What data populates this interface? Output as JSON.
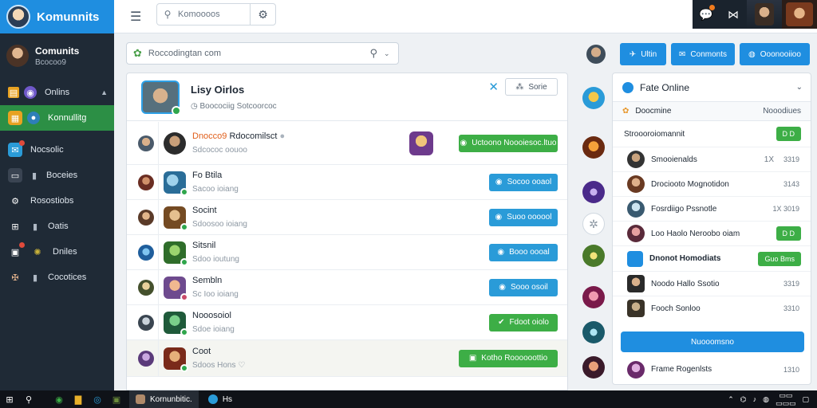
{
  "app": {
    "brand": "Komunnits"
  },
  "user": {
    "name": "Comunits",
    "status": "Bcocoo9"
  },
  "sidebar": {
    "items": [
      {
        "label": "Onlins",
        "icon": "planet-icon",
        "color": "#6f58c9"
      },
      {
        "label": "Konnullitg",
        "icon": "chat-icon",
        "color": "#e8a221",
        "active": true
      },
      {
        "label": "Nocsolic",
        "icon": "bell-icon",
        "color": "#2a9bd8"
      },
      {
        "label": "Boceies",
        "icon": "monitor-icon",
        "color": "#3a4452"
      },
      {
        "label": "Rosostiobs",
        "icon": "gear-icon",
        "color": "#3a4452"
      },
      {
        "label": "Oatis",
        "icon": "grid-icon",
        "color": "#3a4452"
      },
      {
        "label": "Dniles",
        "icon": "dashboard-icon",
        "color": "#3a4452"
      },
      {
        "label": "Cocotices",
        "icon": "gamepad-icon",
        "color": "#3a4452"
      }
    ]
  },
  "topbar": {
    "search_placeholder": "Komoooos"
  },
  "mainsearch": {
    "placeholder": "Roccodingtan com"
  },
  "main": {
    "title": "Lisy Oirlos",
    "subtitle": "Boocociig Sotcoorcoc",
    "sort_label": "Sorie",
    "rows": [
      {
        "name_highlight": "Dnocco9 ",
        "name": "Rdocomilsct",
        "sub": "Sdcococ oouoo",
        "button": "Uctoono Noooiesoc.ltuo",
        "button_style": "greenwide"
      },
      {
        "name": "Fo Btila",
        "sub": "Sacoo ioiang",
        "button": "Socoo ooaol",
        "button_style": "blue"
      },
      {
        "name": "Socint",
        "sub": "Sdoosoo ioiang",
        "button": "Suoo oooool",
        "button_style": "blue"
      },
      {
        "name": "Sitsnil",
        "sub": "Sdoo ioutung",
        "button": "Booo oooal",
        "button_style": "blue"
      },
      {
        "name": "Sembln",
        "sub": "Sc Ioo ioiang",
        "button": "Sooo osoil",
        "button_style": "blue"
      },
      {
        "name": "Nooosoiol",
        "sub": "Sdoe ioiang",
        "button": "Fdoot oiolo",
        "button_style": "green"
      },
      {
        "name": "Coot",
        "sub": "Sdoos Hons ♡",
        "button": "Kotho Roooooottio",
        "button_style": "greenwide"
      }
    ]
  },
  "rightbuttons": [
    "Ultin",
    "Conmonts",
    "Ooonooiioo"
  ],
  "rpanel": {
    "title": "Fate Online",
    "sub_left": "Doocmine",
    "sub_right": "Nooodiues",
    "group1": {
      "label": "Stroooroiomannit",
      "btn": "D D"
    },
    "rows1": [
      {
        "name": "Smooienalds",
        "x": "1X",
        "val": "3319"
      },
      {
        "name": "Drociooto Mognotidon",
        "x": "",
        "val": "3143"
      },
      {
        "name": "Fosrdiigo Pssnotle",
        "x": "X",
        "val": "1X 3019"
      },
      {
        "name": "Loo Haolo Neroobo oiam",
        "x": "",
        "val": "",
        "btn": "D D"
      }
    ],
    "group2": {
      "label": "Dnonot Homodiats",
      "btn": "Guo Bms"
    },
    "rows2": [
      {
        "name": "Noodo Hallo Ssotio",
        "val": "3319"
      },
      {
        "name": "Fooch Sonloo",
        "val": "3310"
      }
    ],
    "cta": "Nuooomsno",
    "last_row": {
      "name": "Frame Rogenlsts",
      "val": "1310"
    }
  },
  "taskbar": {
    "app1": "Kornunbitic.",
    "app2": "Hs"
  },
  "colors": {
    "brand": "#1f8ee0",
    "active": "#2c8f45",
    "green": "#3dae46",
    "blue": "#2a9bd8"
  }
}
